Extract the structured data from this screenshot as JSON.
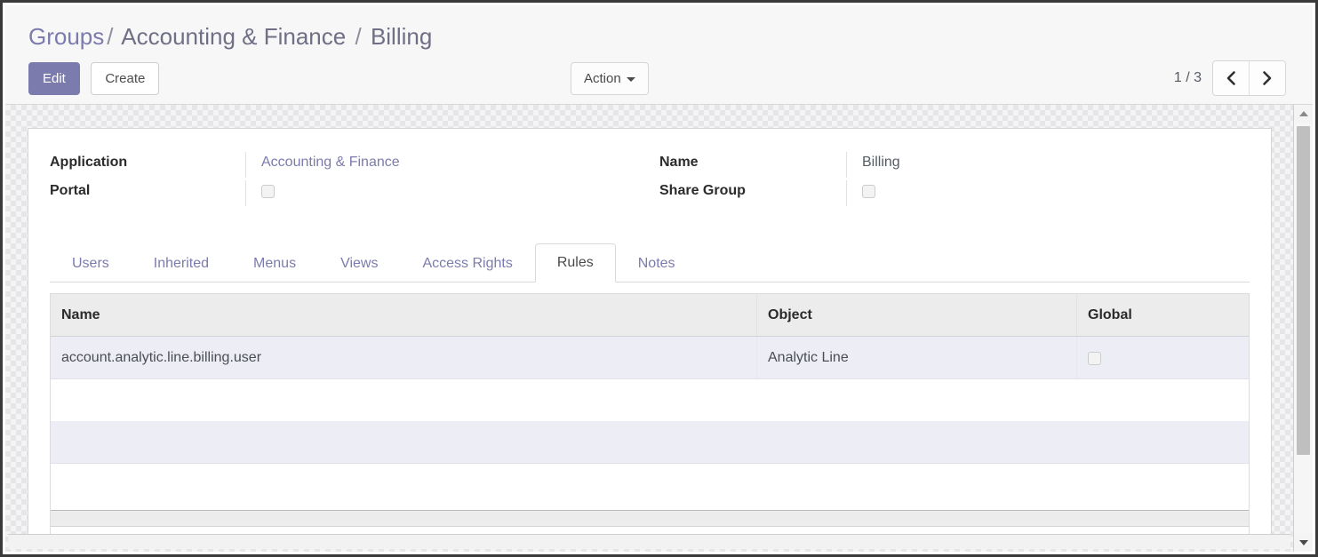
{
  "breadcrumb": {
    "root": "Groups",
    "separator": "/",
    "middle": "Accounting & Finance",
    "current": "Billing"
  },
  "toolbar": {
    "edit_label": "Edit",
    "create_label": "Create",
    "action_label": "Action"
  },
  "pager": {
    "counter": "1 / 3",
    "prev_title": "Previous",
    "next_title": "Next"
  },
  "form": {
    "left": [
      {
        "label": "Application",
        "value": "Accounting & Finance",
        "type": "link"
      },
      {
        "label": "Portal",
        "value": "",
        "type": "checkbox",
        "checked": false
      }
    ],
    "right": [
      {
        "label": "Name",
        "value": "Billing",
        "type": "text"
      },
      {
        "label": "Share Group",
        "value": "",
        "type": "checkbox",
        "checked": false
      }
    ]
  },
  "notebook": {
    "tabs": [
      {
        "label": "Users",
        "active": false
      },
      {
        "label": "Inherited",
        "active": false
      },
      {
        "label": "Menus",
        "active": false
      },
      {
        "label": "Views",
        "active": false
      },
      {
        "label": "Access Rights",
        "active": false
      },
      {
        "label": "Rules",
        "active": true
      },
      {
        "label": "Notes",
        "active": false
      }
    ]
  },
  "rules_list": {
    "columns": [
      "Name",
      "Object",
      "Global"
    ],
    "rows": [
      {
        "name": "account.analytic.line.billing.user",
        "object": "Analytic Line",
        "global": false
      }
    ]
  },
  "colors": {
    "brand": "#7c7bad",
    "row_highlight": "#ededf6",
    "header_bg": "#ececed",
    "text": "#4a4d55"
  }
}
